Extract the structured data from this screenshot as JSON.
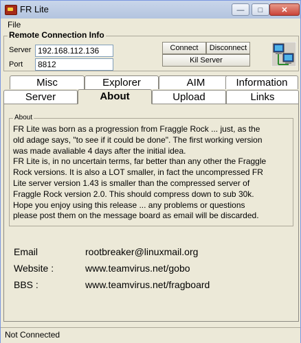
{
  "window": {
    "title": "FR Lite",
    "minimize_glyph": "—",
    "maximize_glyph": "□",
    "close_glyph": "✕"
  },
  "menu": {
    "file": "File"
  },
  "remote": {
    "group_title": "Remote Connection Info",
    "server_label": "Server",
    "server_value": "192.168.112.136",
    "port_label": "Port",
    "port_value": "8812",
    "connect_label": "Connect",
    "disconnect_label": "Disconnect",
    "kill_label": "Kil Server",
    "icon": "network-computers-icon"
  },
  "tabs": {
    "row1": [
      "Misc",
      "Explorer",
      "AIM",
      "Information"
    ],
    "row2": [
      "Server",
      "About",
      "Upload",
      "Links"
    ],
    "active": "About"
  },
  "about": {
    "title": "About",
    "lines": [
      "FR Lite was born as a progression from Fraggle Rock ... just, as the",
      "old adage says, \"to see if it could be done\". The first working version",
      "was made avaliable 4 days after the initial idea.",
      "FR Lite is, in no uncertain terms, far better than any other the Fraggle",
      "Rock versions. It is also a LOT smaller, in fact the uncompressed FR",
      "Lite server version 1.43 is smaller than the compressed server of",
      "Fraggle Rock version 2.0. This should compress down to sub 30k.",
      "Hope you enjoy using this release ... any problems or questions",
      "please post them on the message board as email will be discarded."
    ],
    "email_label": "Email",
    "email_value": "rootbreaker@linuxmail.org",
    "website_label": "Website :",
    "website_value": "www.teamvirus.net/gobo",
    "bbs_label": "BBS :",
    "bbs_value": "www.teamvirus.net/fragboard"
  },
  "status": {
    "text": "Not Connected"
  }
}
